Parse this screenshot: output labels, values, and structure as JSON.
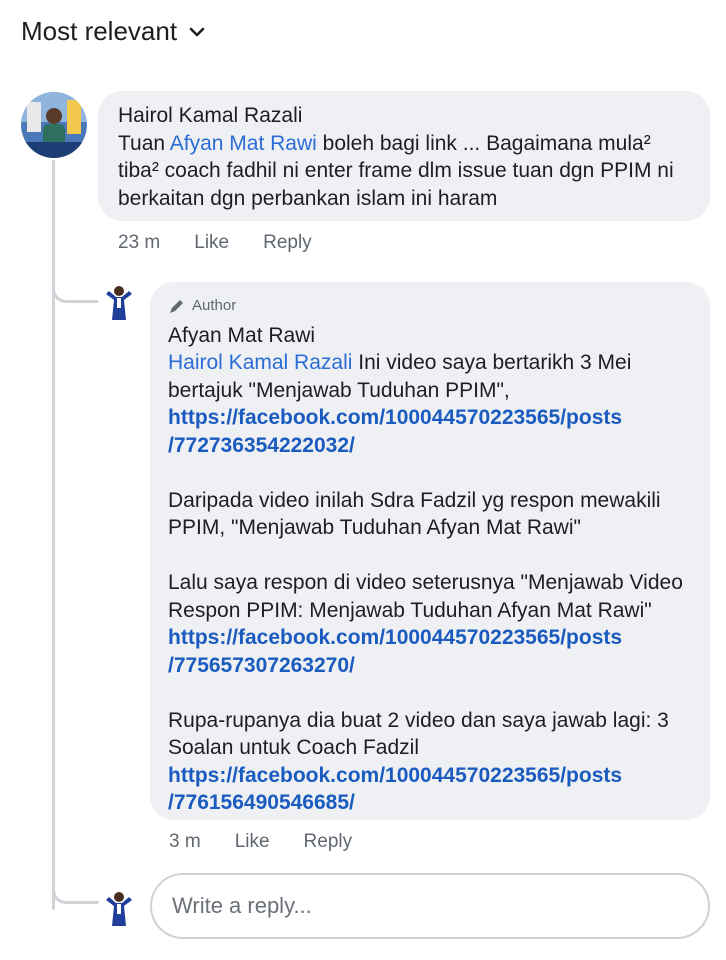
{
  "sort": {
    "label": "Most relevant"
  },
  "comment": {
    "author": "Hairol Kamal Razali",
    "text_prefix": "Tuan ",
    "mention": "Afyan Mat Rawi",
    "text_rest": " boleh bagi link ... Bagaimana mula² tiba² coach fadhil ni enter frame dlm issue tuan dgn PPIM ni berkaitan dgn perbankan islam ini haram",
    "time": "23 m",
    "like": "Like",
    "reply": "Reply"
  },
  "reply": {
    "badge": "Author",
    "author": "Afyan Mat Rawi",
    "mention": "Hairol Kamal Razali",
    "p1_text": " Ini video saya bertarikh 3 Mei bertajuk \"Menjawab Tuduhan PPIM\",",
    "link1_a": "https://facebook.com/100044570223565/posts",
    "link1_b": "/772736354222032/",
    "p2_text": "Daripada video inilah Sdra Fadzil yg respon mewakili PPIM, \"Menjawab Tuduhan Afyan Mat Rawi\"",
    "p3_text": "Lalu saya respon di video seterusnya \"Menjawab Video Respon PPIM: Menjawab Tuduhan Afyan Mat Rawi\"",
    "link2_a": "https://facebook.com/100044570223565/posts",
    "link2_b": "/775657307263270/",
    "p4_text": "Rupa-rupanya dia buat 2 video dan saya jawab lagi: 3 Soalan untuk Coach Fadzil",
    "link3_a": "https://facebook.com/100044570223565/posts",
    "link3_b": "/776156490546685/",
    "time": "3 m",
    "like": "Like",
    "reply": "Reply"
  },
  "composer": {
    "placeholder": "Write a reply..."
  },
  "colors": {
    "bubble": "#eef0f3",
    "mention": "#2b6cd6",
    "link": "#1a5bbf",
    "meta": "#606770"
  }
}
